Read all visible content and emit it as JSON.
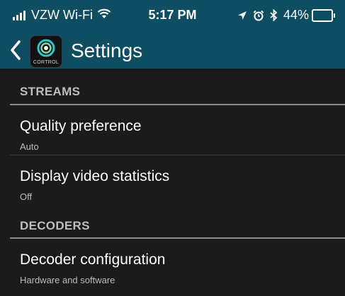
{
  "status_bar": {
    "carrier": "VZW Wi-Fi",
    "time": "5:17 PM",
    "battery_percent": "44%",
    "battery_level": 0.44,
    "icons": [
      "signal-icon",
      "wifi-icon",
      "location-icon",
      "alarm-icon",
      "bluetooth-icon",
      "battery-icon"
    ]
  },
  "app_bar": {
    "title": "Settings",
    "logo_text": "CORTROL",
    "back_icon": "chevron-left-icon"
  },
  "sections": [
    {
      "header": "STREAMS",
      "items": [
        {
          "title": "Quality preference",
          "value": "Auto"
        },
        {
          "title": "Display video statistics",
          "value": "Off"
        }
      ]
    },
    {
      "header": "DECODERS",
      "items": [
        {
          "title": "Decoder configuration",
          "value": "Hardware and software"
        }
      ]
    }
  ],
  "colors": {
    "app_bar": "#0f4d63",
    "background": "#1b1b1b",
    "accent": "#2ec4c9"
  }
}
